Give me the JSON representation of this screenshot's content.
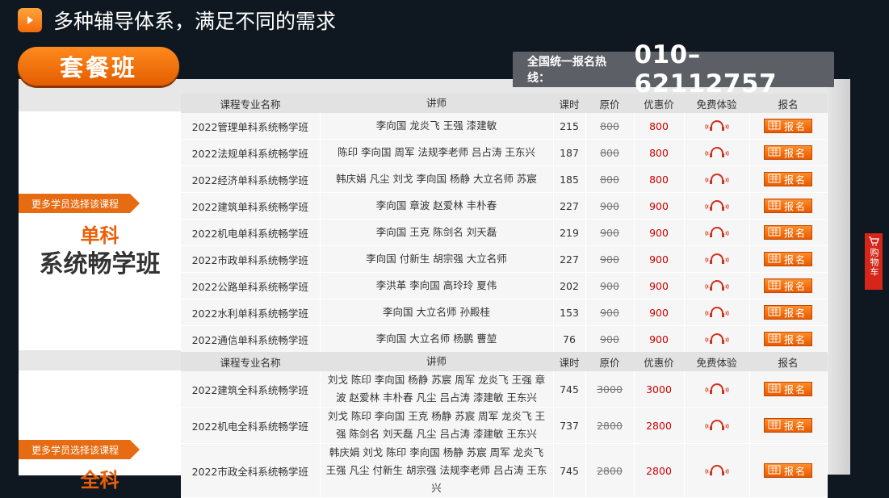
{
  "page_title": "多种辅导体系，满足不同的需求",
  "package_tab": "套餐班",
  "hotline": {
    "label": "全国统一报名热线：",
    "number": "010–62112757"
  },
  "side_cart": "购物车",
  "headers": {
    "name": "课程专业名称",
    "teacher": "讲师",
    "hours": "课时",
    "orig": "原价",
    "price": "优惠价",
    "trial": "免费体验",
    "enroll": "报名"
  },
  "enroll_label": "报名",
  "section1": {
    "ribbon": "更多学员选择该课程",
    "cat_main": "单科",
    "cat_sub": "系统畅学班",
    "rows": [
      {
        "name": "2022管理单科系统畅学班",
        "teacher": "李向国 龙炎飞 王强 漆建敏",
        "hours": "215",
        "orig": "800",
        "price": "800"
      },
      {
        "name": "2022法规单科系统畅学班",
        "teacher": "陈印 李向国 周军 法规李老师 吕占涛 王东兴",
        "hours": "187",
        "orig": "800",
        "price": "800"
      },
      {
        "name": "2022经济单科系统畅学班",
        "teacher": "韩庆娟 凡尘 刘戈 李向国 杨静 大立名师 苏宸",
        "hours": "185",
        "orig": "800",
        "price": "800"
      },
      {
        "name": "2022建筑单科系统畅学班",
        "teacher": "李向国 章波 赵爱林 丰朴春",
        "hours": "227",
        "orig": "900",
        "price": "900"
      },
      {
        "name": "2022机电单科系统畅学班",
        "teacher": "李向国 王克 陈剑名 刘天磊",
        "hours": "219",
        "orig": "900",
        "price": "900"
      },
      {
        "name": "2022市政单科系统畅学班",
        "teacher": "李向国 付新生 胡宗强 大立名师",
        "hours": "227",
        "orig": "900",
        "price": "900"
      },
      {
        "name": "2022公路单科系统畅学班",
        "teacher": "李洪革 李向国 高玲玲 夏伟",
        "hours": "202",
        "orig": "900",
        "price": "900"
      },
      {
        "name": "2022水利单科系统畅学班",
        "teacher": "李向国 大立名师 孙殿桂",
        "hours": "153",
        "orig": "900",
        "price": "900"
      },
      {
        "name": "2022通信单科系统畅学班",
        "teacher": "李向国 大立名师 杨鹏 曹堃",
        "hours": "76",
        "orig": "900",
        "price": "900"
      }
    ]
  },
  "section2": {
    "ribbon": "更多学员选择该课程",
    "cat_main": "全科",
    "rows": [
      {
        "name": "2022建筑全科系统畅学班",
        "teacher": "刘戈 陈印 李向国 杨静 苏宸 周军 龙炎飞 王强 章波 赵爱林 丰朴春 凡尘 吕占涛 漆建敏 王东兴",
        "hours": "745",
        "orig": "3000",
        "price": "3000"
      },
      {
        "name": "2022机电全科系统畅学班",
        "teacher": "刘戈 陈印 李向国 王克 杨静 苏宸 周军 龙炎飞 王强 陈剑名 刘天磊 凡尘 吕占涛 漆建敏 王东兴",
        "hours": "737",
        "orig": "2800",
        "price": "2800"
      },
      {
        "name": "2022市政全科系统畅学班",
        "teacher": "韩庆娟 刘戈 陈印 李向国 杨静 苏宸 周军 龙炎飞 王强 凡尘 付新生 胡宗强 法规李老师 吕占涛 王东兴",
        "hours": "745",
        "orig": "2800",
        "price": "2800"
      }
    ]
  }
}
